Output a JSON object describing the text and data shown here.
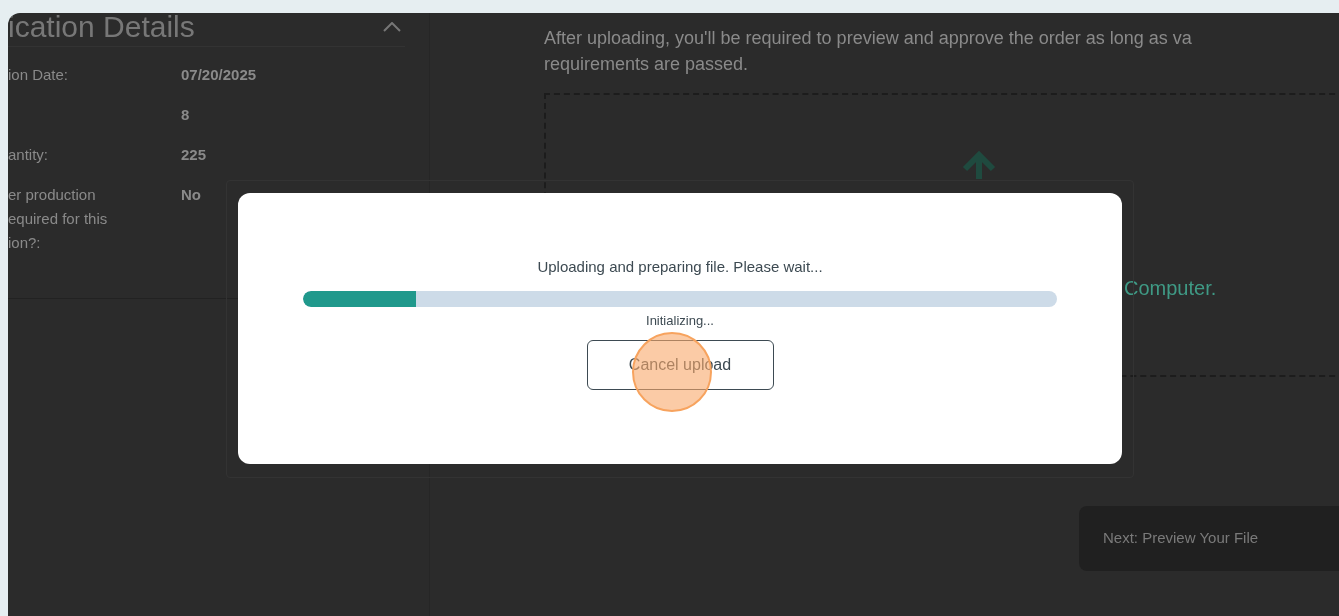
{
  "details": {
    "title": "ication Details",
    "rows": [
      {
        "label": "ion Date:",
        "value": "07/20/2025"
      },
      {
        "value": "8"
      },
      {
        "label": "antity:",
        "value": "225"
      },
      {
        "label": "er production equired for this ion?:",
        "value": "No"
      }
    ]
  },
  "upload": {
    "description_lines": [
      "After uploading, you'll be required to preview and approve the order as long as va",
      "requirements are passed."
    ],
    "drop_text": "Computer.",
    "next_button": {
      "label": "Next: Preview Your File",
      "disabled": true
    }
  },
  "modal": {
    "message": "Uploading and preparing file. Please wait...",
    "progress": {
      "level": 0.15
    },
    "status": "Initializing...",
    "cancel_button": "Cancel upload"
  }
}
